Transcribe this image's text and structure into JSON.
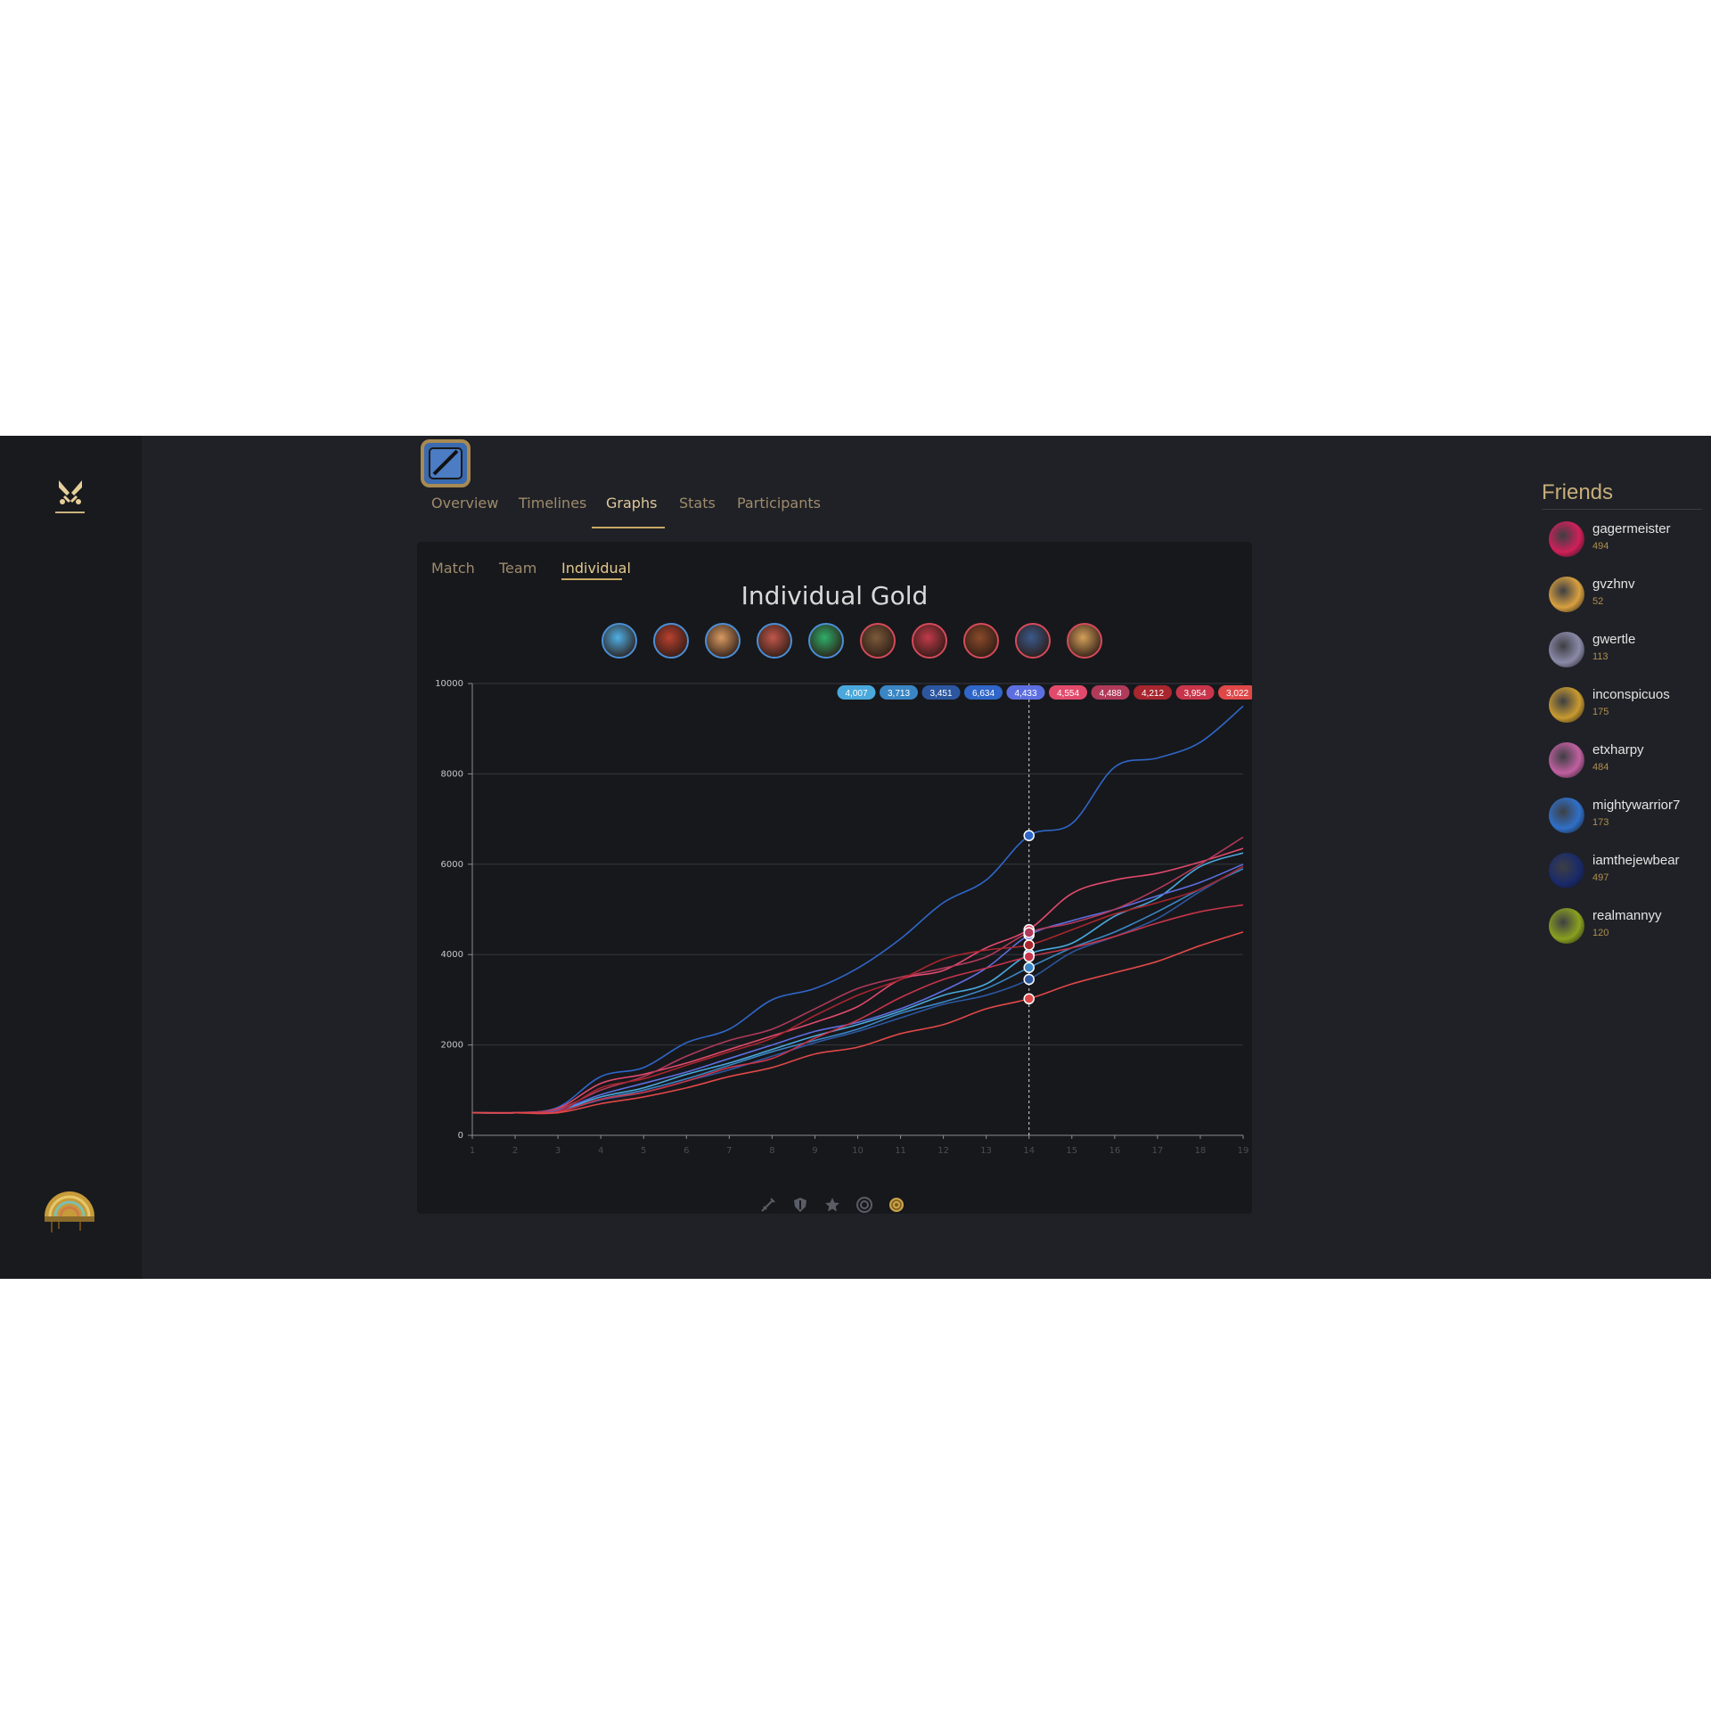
{
  "nav": {
    "tabs": [
      "Overview",
      "Timelines",
      "Graphs",
      "Stats",
      "Participants"
    ],
    "active_tab": "Graphs"
  },
  "graphs": {
    "subtabs": [
      "Match",
      "Team",
      "Individual"
    ],
    "active_subtab": "Individual"
  },
  "champions": [
    {
      "team": "blue",
      "icon": "champion-portrait-1-icon",
      "color": "#4fb0e6"
    },
    {
      "team": "blue",
      "icon": "champion-portrait-2-icon",
      "color": "#b9412f"
    },
    {
      "team": "blue",
      "icon": "champion-portrait-3-icon",
      "color": "#d89a62"
    },
    {
      "team": "blue",
      "icon": "champion-portrait-4-icon",
      "color": "#c0574a"
    },
    {
      "team": "blue",
      "icon": "champion-portrait-5-icon",
      "color": "#2fae6a"
    },
    {
      "team": "red",
      "icon": "champion-portrait-6-icon",
      "color": "#7b5a3a"
    },
    {
      "team": "red",
      "icon": "champion-portrait-7-icon",
      "color": "#c23a4a"
    },
    {
      "team": "red",
      "icon": "champion-portrait-8-icon",
      "color": "#8a4a2a"
    },
    {
      "team": "red",
      "icon": "champion-portrait-9-icon",
      "color": "#3a5a8a"
    },
    {
      "team": "red",
      "icon": "champion-portrait-10-icon",
      "color": "#d4a05a"
    }
  ],
  "chart_data": {
    "type": "line",
    "title": "Individual Gold",
    "xlabel": "",
    "ylabel": "",
    "x": [
      1,
      2,
      3,
      4,
      5,
      6,
      7,
      8,
      9,
      10,
      11,
      12,
      13,
      14,
      15,
      16,
      17,
      18,
      19
    ],
    "ylim": [
      0,
      10000
    ],
    "yticks": [
      0,
      2000,
      4000,
      6000,
      8000,
      10000
    ],
    "grid": true,
    "hover_x": 14,
    "series": [
      {
        "color": "#4aa8dc",
        "values": [
          500,
          500,
          550,
          850,
          1050,
          1350,
          1600,
          1900,
          2200,
          2450,
          2750,
          3100,
          3350,
          4007,
          4250,
          4850,
          5250,
          5950,
          6250
        ]
      },
      {
        "color": "#3a86c4",
        "values": [
          500,
          500,
          530,
          800,
          1000,
          1250,
          1550,
          1850,
          2100,
          2350,
          2700,
          2950,
          3250,
          3713,
          4150,
          4500,
          4950,
          5450,
          5900
        ]
      },
      {
        "color": "#2c57a0",
        "values": [
          500,
          500,
          540,
          780,
          950,
          1200,
          1450,
          1750,
          2050,
          2300,
          2600,
          2900,
          3100,
          3451,
          4050,
          4400,
          4800,
          5400,
          5950
        ]
      },
      {
        "color": "#2f66c8",
        "values": [
          500,
          500,
          620,
          1300,
          1500,
          2050,
          2350,
          3000,
          3250,
          3700,
          4350,
          5150,
          5650,
          6634,
          6900,
          8150,
          8350,
          8700,
          9500
        ]
      },
      {
        "color": "#5d6fe0",
        "values": [
          500,
          500,
          560,
          900,
          1150,
          1400,
          1700,
          2000,
          2300,
          2500,
          2800,
          3200,
          3700,
          4433,
          4750,
          5000,
          5300,
          5600,
          6000
        ]
      },
      {
        "color": "#e24a6c",
        "values": [
          500,
          500,
          600,
          1150,
          1350,
          1600,
          1900,
          2200,
          2500,
          2850,
          3450,
          3650,
          4150,
          4554,
          5350,
          5650,
          5800,
          6050,
          6350
        ]
      },
      {
        "color": "#b03a5a",
        "values": [
          500,
          500,
          580,
          1000,
          1300,
          1750,
          2100,
          2350,
          2800,
          3250,
          3500,
          3700,
          3950,
          4488,
          4700,
          5000,
          5450,
          6000,
          6600
        ]
      },
      {
        "color": "#a8262e",
        "values": [
          500,
          500,
          530,
          1050,
          1250,
          1550,
          1850,
          2150,
          2650,
          3100,
          3450,
          3900,
          4100,
          4212,
          4550,
          4900,
          5150,
          5450,
          5950
        ]
      },
      {
        "color": "#c8354a",
        "values": [
          500,
          500,
          520,
          800,
          950,
          1200,
          1500,
          1700,
          2150,
          2550,
          3050,
          3450,
          3700,
          3954,
          4150,
          4400,
          4700,
          4950,
          5100
        ]
      },
      {
        "color": "#e04848",
        "values": [
          500,
          500,
          500,
          700,
          850,
          1050,
          1300,
          1500,
          1800,
          1950,
          2250,
          2450,
          2800,
          3022,
          3350,
          3600,
          3850,
          4200,
          4500
        ]
      }
    ]
  },
  "bottom_icons": [
    "sword-icon",
    "shield-icon",
    "star-icon",
    "target-icon",
    "coin-icon"
  ],
  "friends": {
    "title": "Friends",
    "list": [
      {
        "name": "gagermeister",
        "level": "494",
        "color": "#d0205a"
      },
      {
        "name": "gvzhnv",
        "level": "52",
        "color": "#d8a040"
      },
      {
        "name": "gwertle",
        "level": "113",
        "color": "#8a8aa8"
      },
      {
        "name": "inconspicuos",
        "level": "175",
        "color": "#c89a30"
      },
      {
        "name": "etxharpy",
        "level": "484",
        "color": "#c060a0"
      },
      {
        "name": "mightywarrior7",
        "level": "173",
        "color": "#3070c8"
      },
      {
        "name": "iamthejewbear",
        "level": "497",
        "color": "#1a2a6a"
      },
      {
        "name": "realmannyy",
        "level": "120",
        "color": "#8aa020"
      }
    ]
  }
}
